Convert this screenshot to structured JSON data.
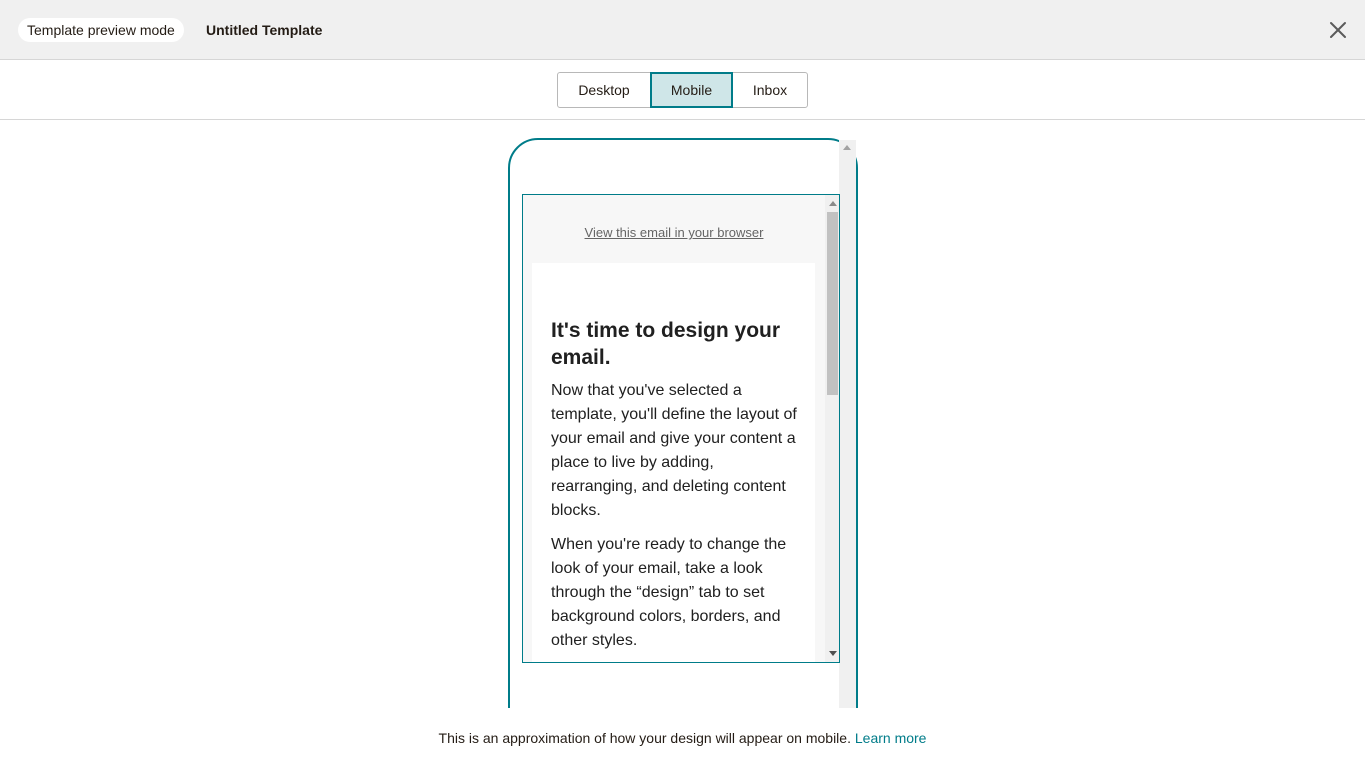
{
  "header": {
    "mode_label": "Template preview mode",
    "template_name": "Untitled Template",
    "close_icon": "close-icon"
  },
  "view_toggle": {
    "options": [
      {
        "label": "Desktop",
        "active": false
      },
      {
        "label": "Mobile",
        "active": true
      },
      {
        "label": "Inbox",
        "active": false
      }
    ]
  },
  "email": {
    "view_in_browser_link": "View this email in your browser",
    "heading": "It's time to design your email.",
    "paragraphs": [
      "Now that you've selected a template, you'll define the layout of your email and give your content a place to live by adding, rearranging, and deleting content blocks.",
      "When you're ready to change the look of your email, take a look through the “design” tab to set background colors, borders, and other styles."
    ]
  },
  "footer": {
    "note": "This is an approximation of how your design will appear on mobile.",
    "learn_more_link": "Learn more"
  },
  "colors": {
    "accent": "#007c89",
    "active_toggle_bg": "#cfe6e8",
    "header_bg": "#f0f0f0"
  }
}
